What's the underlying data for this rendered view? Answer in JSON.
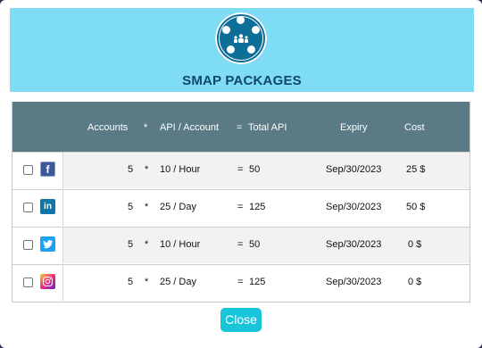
{
  "header": {
    "title": "SMAP PACKAGES"
  },
  "table": {
    "columns": {
      "accounts": "Accounts",
      "mult": "*",
      "api_per_account": "API / Account",
      "eq": "=",
      "total_api": "Total API",
      "expiry": "Expiry",
      "cost": "Cost"
    },
    "rows": [
      {
        "network": "facebook",
        "accounts": "5",
        "mult": "*",
        "api_per_account": "10 / Hour",
        "eq": "=",
        "total_api": "50",
        "expiry": "Sep/30/2023",
        "cost": "25 $"
      },
      {
        "network": "linkedin",
        "accounts": "5",
        "mult": "*",
        "api_per_account": "25 / Day",
        "eq": "=",
        "total_api": "125",
        "expiry": "Sep/30/2023",
        "cost": "50 $"
      },
      {
        "network": "twitter",
        "accounts": "5",
        "mult": "*",
        "api_per_account": "10 / Hour",
        "eq": "=",
        "total_api": "50",
        "expiry": "Sep/30/2023",
        "cost": "0 $"
      },
      {
        "network": "instagram",
        "accounts": "5",
        "mult": "*",
        "api_per_account": "25 / Day",
        "eq": "=",
        "total_api": "125",
        "expiry": "Sep/30/2023",
        "cost": "0 $"
      }
    ]
  },
  "icons": {
    "facebook": "f",
    "linkedin": "in",
    "twitter": "🐦",
    "instagram": "◎"
  },
  "footer": {
    "close_label": "Close"
  },
  "colors": {
    "header_bg": "#7fdcf5",
    "table_head_bg": "#5a7b86",
    "close_button_bg": "#19c6d9"
  }
}
